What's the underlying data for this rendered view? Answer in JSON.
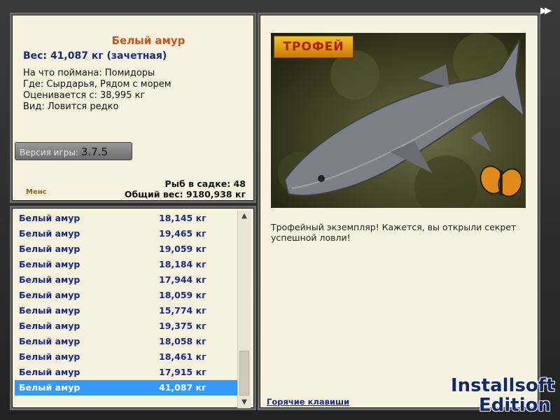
{
  "fish": {
    "name": "Белый амур",
    "weight": "Вес: 41,087 кг (зачетная)",
    "bait": "На что поймана: Помидоры",
    "location": "Где: Сырдарья, Рядом с морем",
    "estimate": "Оценивается с: 38,995 кг",
    "rarity": "Вид: Ловится редко"
  },
  "version": {
    "label": "Версия игры:",
    "value": "3.7.5"
  },
  "small_logo": "Менс",
  "cage": {
    "count": "Рыб в садке: 48",
    "total": "Общий вес: 9180,938 кг"
  },
  "catch_list": [
    {
      "name": "Белый амур",
      "weight": "18,145 кг"
    },
    {
      "name": "Белый амур",
      "weight": "19,465 кг"
    },
    {
      "name": "Белый амур",
      "weight": "19,059 кг"
    },
    {
      "name": "Белый амур",
      "weight": "18,184 кг"
    },
    {
      "name": "Белый амур",
      "weight": "17,944 кг"
    },
    {
      "name": "Белый амур",
      "weight": "18,059 кг"
    },
    {
      "name": "Белый амур",
      "weight": "15,774 кг"
    },
    {
      "name": "Белый амур",
      "weight": "19,375 кг"
    },
    {
      "name": "Белый амур",
      "weight": "18,058 кг"
    },
    {
      "name": "Белый амур",
      "weight": "18,461 кг"
    },
    {
      "name": "Белый амур",
      "weight": "17,915 кг"
    },
    {
      "name": "Белый амур",
      "weight": "41,087 кг",
      "selected": true
    }
  ],
  "trophy_badge": "ТРОФЕЙ",
  "caption": "Трофейный экземпляр! Кажется, вы открыли секрет успешной ловли!",
  "hotkeys": "Горячие клавиши",
  "edition": {
    "line1": "Installsoft",
    "line2": "Edition"
  },
  "icons": {
    "forward": "double-arrow-icon",
    "scroll_up": "chevron-up-icon",
    "scroll_down": "chevron-down-icon"
  }
}
